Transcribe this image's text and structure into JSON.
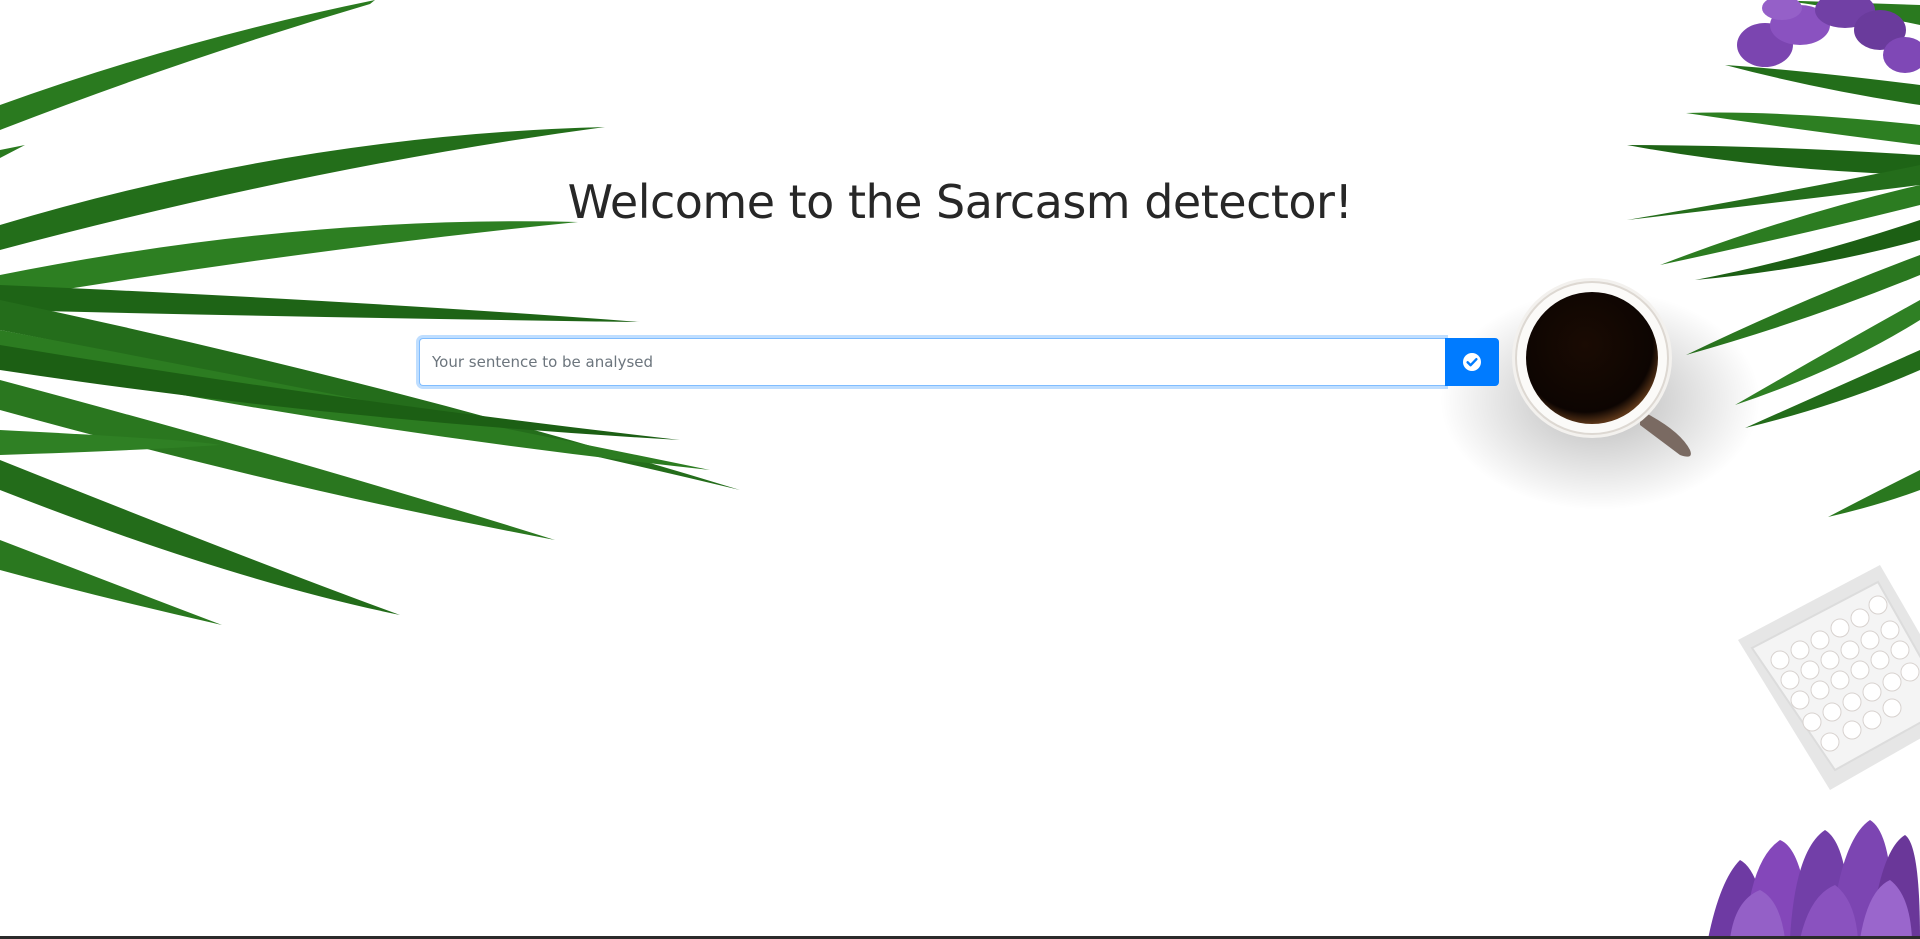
{
  "page": {
    "title": "Welcome to the Sarcasm detector!"
  },
  "form": {
    "input_value": "",
    "input_placeholder": "Your sentence to be analysed",
    "submit_icon": "check-circle-icon"
  },
  "colors": {
    "accent": "#007bff",
    "title": "#272727",
    "leaf": "#1f6b1a",
    "tulip": "#7a3fb0",
    "coffee": "#1a0d05",
    "background": "#ffffff"
  },
  "decorations": [
    "palm-leaves",
    "coffee-cup",
    "tulips",
    "candy-dish"
  ]
}
